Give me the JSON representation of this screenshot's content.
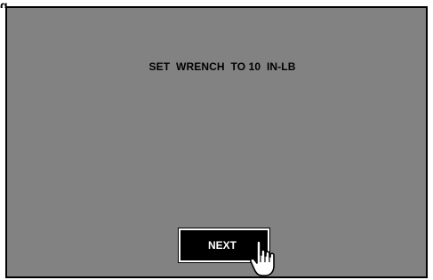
{
  "caption": "g",
  "screen": {
    "instruction": "SET  WRENCH  TO 10  IN-LB",
    "next_button_label": "NEXT",
    "pointer_icon": "hand-pointer-icon"
  },
  "colors": {
    "screen_background": "#828282",
    "button_background": "#000000",
    "button_text": "#ffffff",
    "border": "#000000"
  }
}
